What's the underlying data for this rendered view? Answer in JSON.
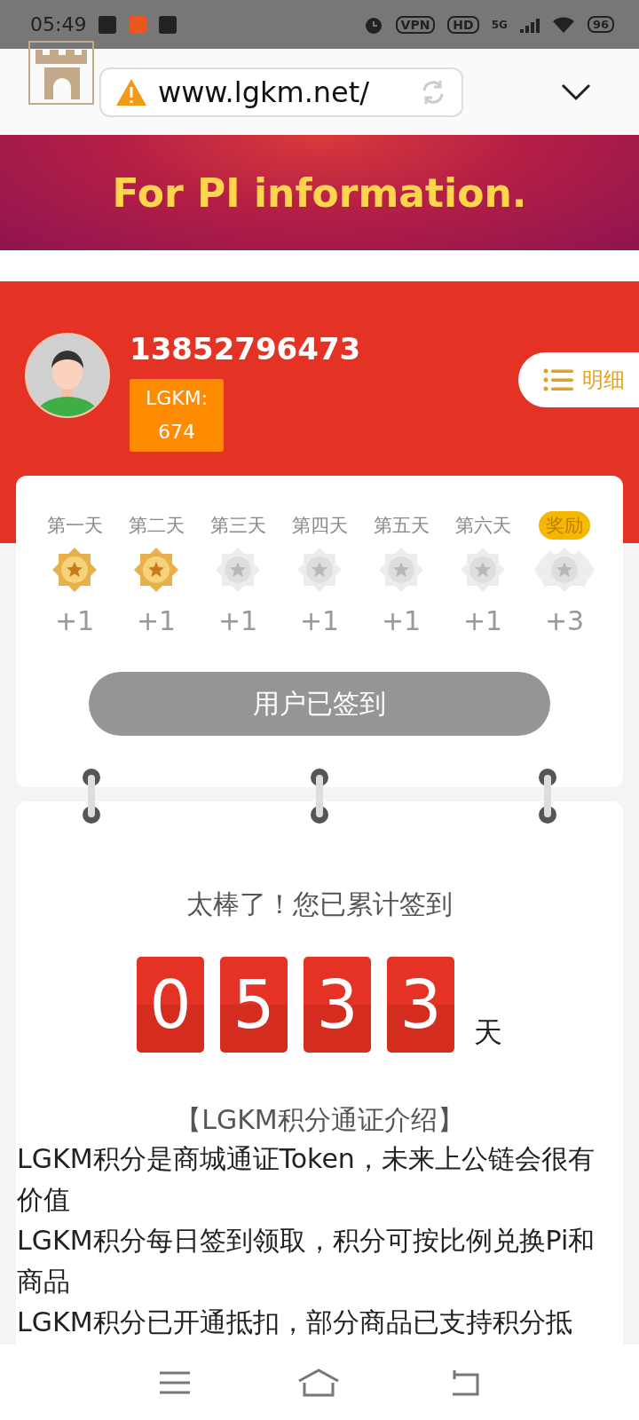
{
  "status_bar": {
    "time": "05:49",
    "vpn": "VPN",
    "hd": "HD",
    "network": "5G",
    "battery": "96"
  },
  "browser": {
    "url": "www.lgkm.net/"
  },
  "banner": {
    "text": "For PI information."
  },
  "profile": {
    "phone": "13852796473",
    "points_label": "LGKM:",
    "points": "674",
    "detail_button": "明细"
  },
  "checkin": {
    "days": [
      {
        "kind": "day",
        "label": "第一天",
        "checked": true,
        "reward": "+1"
      },
      {
        "kind": "day",
        "label": "第二天",
        "checked": true,
        "reward": "+1"
      },
      {
        "kind": "day",
        "label": "第三天",
        "checked": false,
        "reward": "+1"
      },
      {
        "kind": "day",
        "label": "第四天",
        "checked": false,
        "reward": "+1"
      },
      {
        "kind": "day",
        "label": "第五天",
        "checked": false,
        "reward": "+1"
      },
      {
        "kind": "day",
        "label": "第六天",
        "checked": false,
        "reward": "+1"
      },
      {
        "kind": "bonus",
        "label": "奖励",
        "checked": false,
        "reward": "+3"
      }
    ],
    "button": {
      "label": "用户已签到",
      "disabled": true
    }
  },
  "total": {
    "title": "太棒了！您已累计签到",
    "digits": [
      "0",
      "5",
      "3",
      "3"
    ],
    "unit": "天"
  },
  "intro": {
    "title": "【LGKM积分通证介绍】",
    "lines": [
      "LGKM积分是商城通证Token，未来上公链会很有价值",
      "LGKM积分每日签到领取，积分可按比例兑换Pi和商品",
      "LGKM积分已开通抵扣，部分商品已支持积分抵"
    ]
  }
}
